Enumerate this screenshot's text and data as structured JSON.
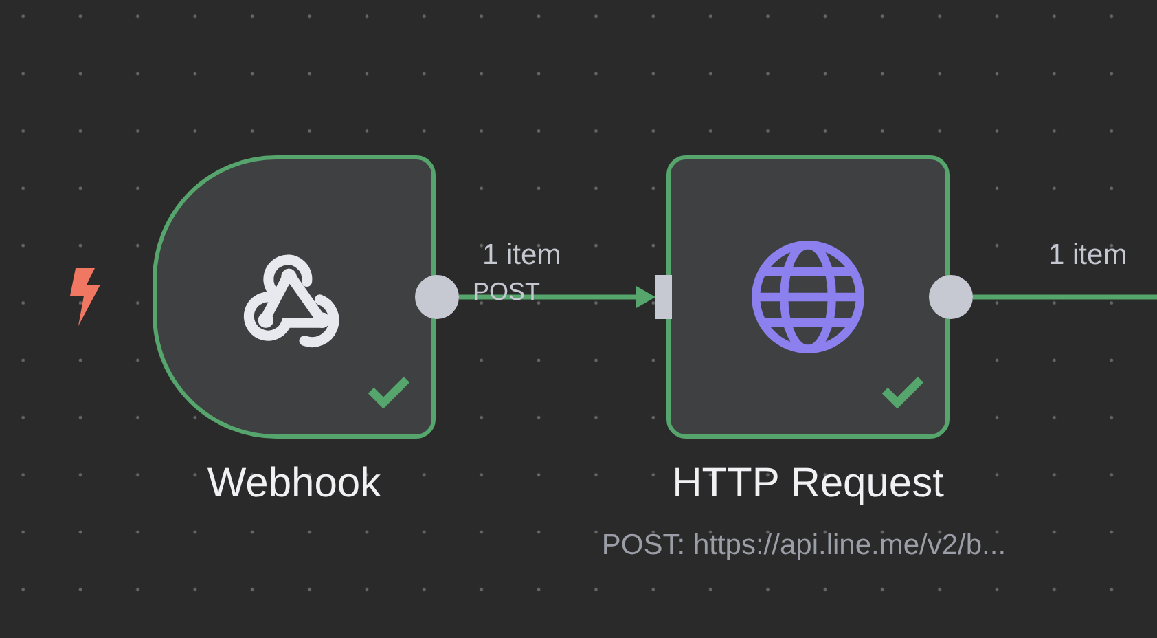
{
  "nodes": [
    {
      "kind": "webhook",
      "trigger": true,
      "title": "Webhook",
      "executed": true,
      "output_label": "POST"
    },
    {
      "kind": "http",
      "trigger": false,
      "title": "HTTP Request",
      "subtitle": "POST: https://api.line.me/v2/b...",
      "executed": true
    }
  ],
  "connections": [
    {
      "label": "1 item",
      "arrow": true
    },
    {
      "label": "1 item",
      "arrow": false
    }
  ]
}
